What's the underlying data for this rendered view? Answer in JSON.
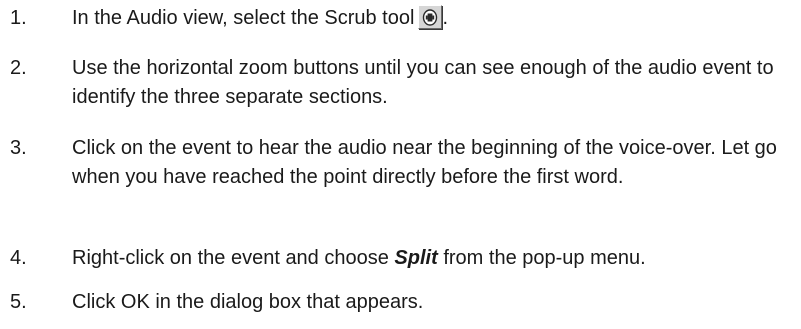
{
  "steps": [
    {
      "number": "1.",
      "text_before": "In the Audio view, select the Scrub tool",
      "icon": "scrub-tool-icon",
      "text_after": "."
    },
    {
      "number": "2.",
      "text": "Use the horizontal zoom buttons until you can see enough of the audio event to identify the three separate sections."
    },
    {
      "number": "3.",
      "text": "Click on the event to hear the audio near the beginning of the voice-over. Let go when you have reached the point directly before the first word."
    },
    {
      "number": "4.",
      "text_before": "Right-click on the event and choose",
      "emphasis": "Split",
      "text_after": "from the pop-up menu."
    },
    {
      "number": "5.",
      "text": "Click OK in the dialog box that appears."
    }
  ]
}
